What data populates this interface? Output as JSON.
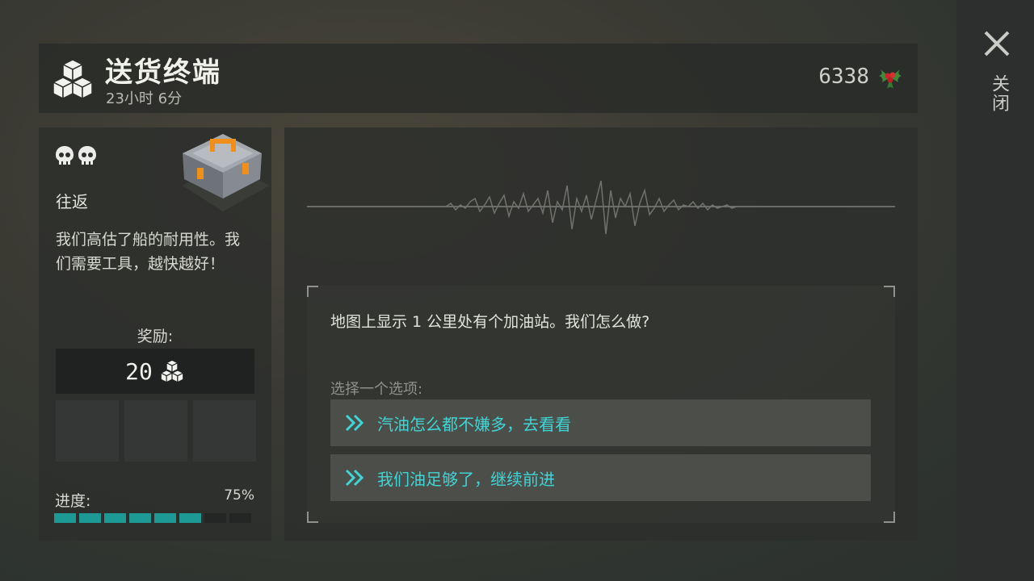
{
  "header": {
    "title": "送货终端",
    "timer": "23小时 6分",
    "currency_amount": "6338",
    "icons": {
      "title": "boxes-icon",
      "currency": "holly-icon"
    }
  },
  "close": {
    "label": "关闭",
    "icon": "close-icon"
  },
  "mission": {
    "difficulty_icons": [
      "skull-icon",
      "skull-icon"
    ],
    "route": "往返",
    "item_icon": "toolbox-icon",
    "description": "我们高估了船的耐用性。我们需要工具，越快越好！",
    "reward_label": "奖励:",
    "reward_amount": "20",
    "reward_icon": "boxes-icon",
    "progress_label": "进度:",
    "progress_percent": "75%",
    "progress_fraction": 0.75,
    "progress_segments": 8
  },
  "event": {
    "question": "地图上显示 1 公里处有个加油站。我们怎么做?",
    "choose_label": "选择一个选项:",
    "options": [
      {
        "label": "汽油怎么都不嫌多，去看看",
        "icon": "double-chevron-icon"
      },
      {
        "label": "我们油足够了，继续前进",
        "icon": "double-chevron-icon"
      }
    ]
  },
  "colors": {
    "accent": "#3fd5d6",
    "progress": "#1e9a96",
    "panel": "#2c2e2c"
  }
}
